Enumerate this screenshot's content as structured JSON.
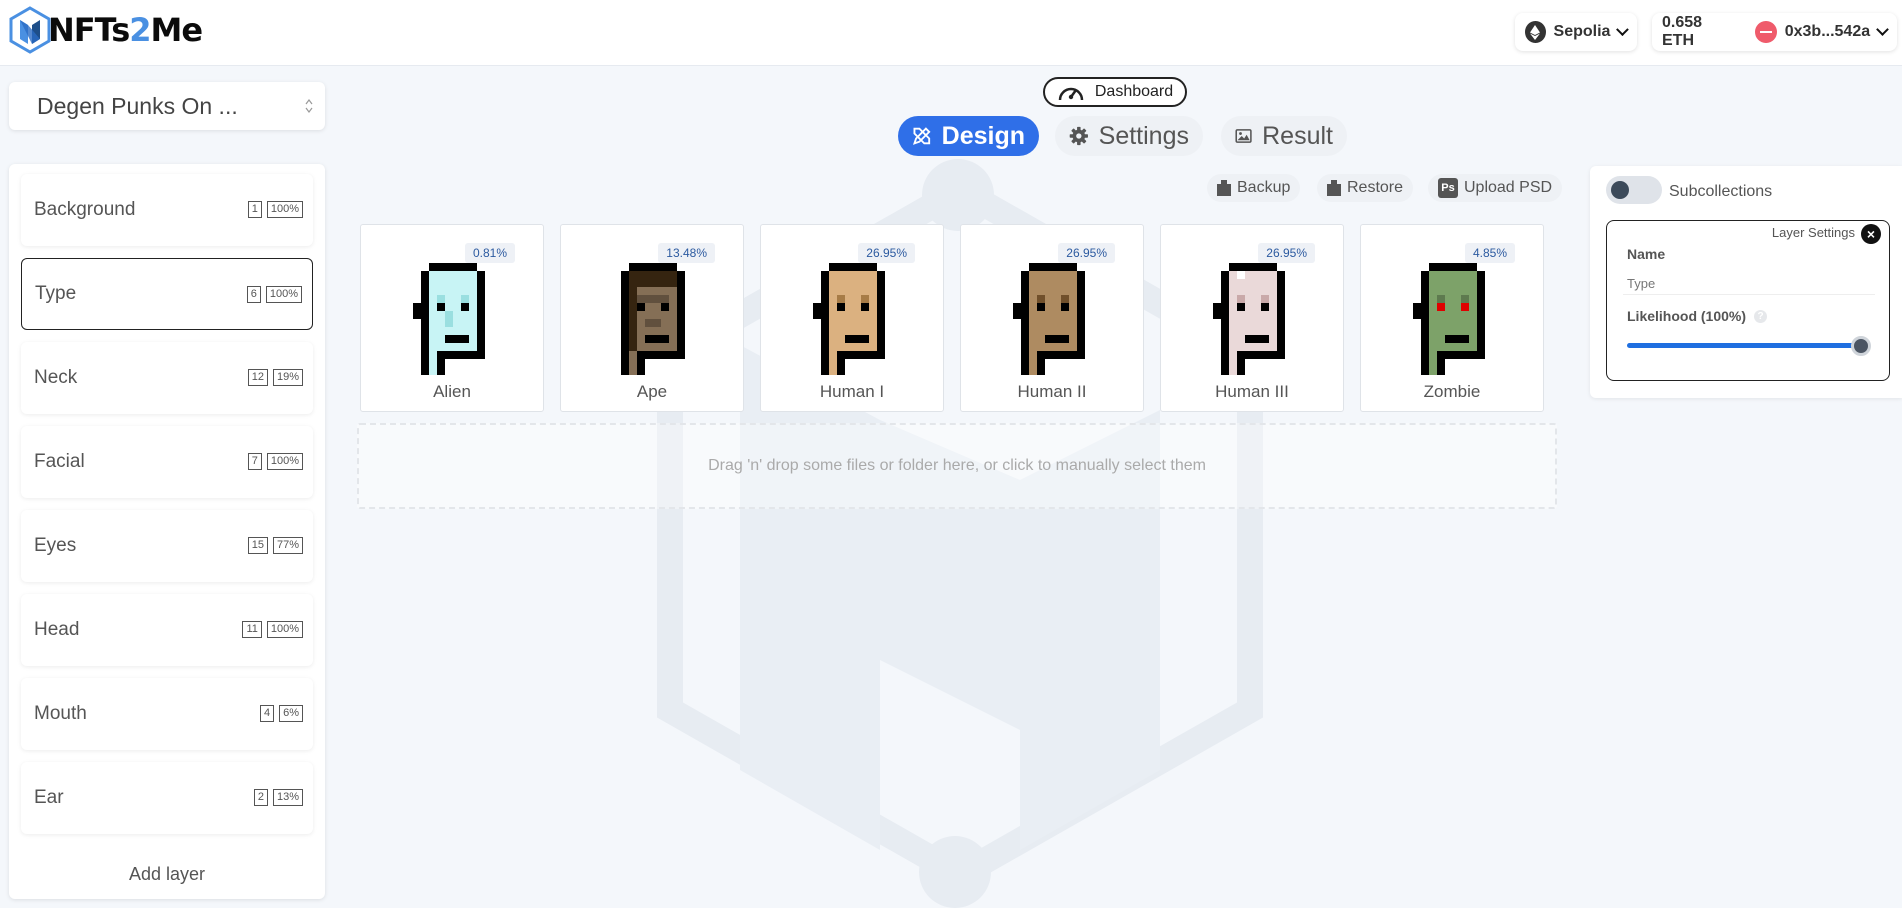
{
  "header": {
    "logo": "NFTs2Me",
    "network": "Sepolia",
    "balance": "0.658 ETH",
    "address": "0x3b...542a"
  },
  "collection": {
    "name": "Degen Punks On ..."
  },
  "layers": [
    {
      "name": "Background",
      "count": "1",
      "pct": "100%"
    },
    {
      "name": "Type",
      "count": "6",
      "pct": "100%"
    },
    {
      "name": "Neck",
      "count": "12",
      "pct": "19%"
    },
    {
      "name": "Facial",
      "count": "7",
      "pct": "100%"
    },
    {
      "name": "Eyes",
      "count": "15",
      "pct": "77%"
    },
    {
      "name": "Head",
      "count": "11",
      "pct": "100%"
    },
    {
      "name": "Mouth",
      "count": "4",
      "pct": "6%"
    },
    {
      "name": "Ear",
      "count": "2",
      "pct": "13%"
    }
  ],
  "add_layer_label": "Add layer",
  "nav": {
    "dashboard": "Dashboard",
    "tabs": [
      "Design",
      "Settings",
      "Result"
    ]
  },
  "toolbar": {
    "backup": "Backup",
    "restore": "Restore",
    "upload_psd": "Upload PSD"
  },
  "traits": [
    {
      "name": "Alien",
      "pct": "0.81%",
      "skin": "#c8f4f5",
      "shade": "#9adfe0"
    },
    {
      "name": "Ape",
      "pct": "13.48%",
      "skin": "#856f56",
      "shade": "#61503e"
    },
    {
      "name": "Human I",
      "pct": "26.95%",
      "skin": "#dbb180",
      "shade": "#a77c47"
    },
    {
      "name": "Human II",
      "pct": "26.95%",
      "skin": "#ae8b61",
      "shade": "#71502b"
    },
    {
      "name": "Human III",
      "pct": "26.95%",
      "skin": "#ead9d9",
      "shade": "#c9a9a9"
    },
    {
      "name": "Zombie",
      "pct": "4.85%",
      "skin": "#7da269",
      "shade": "#5e7a4f"
    }
  ],
  "dropzone_text": "Drag 'n' drop some files or folder here, or click to manually select them",
  "right_panel": {
    "subcollections_label": "Subcollections",
    "layer_settings_title": "Layer Settings",
    "name_label": "Name",
    "name_value": "Type",
    "likelihood_label": "Likelihood (100%)",
    "likelihood_value": 1.0
  },
  "colors": {
    "accent": "#2f6fe8",
    "slider": "#1f6fe0"
  }
}
